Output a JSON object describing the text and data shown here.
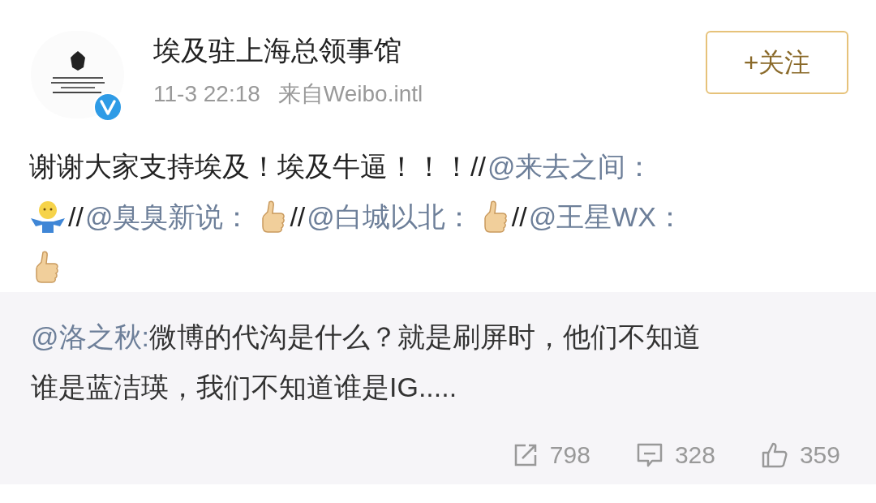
{
  "post": {
    "author": "埃及驻上海总领事馆",
    "verified": true,
    "time": "11-3 22:18",
    "source": "来自Weibo.intl",
    "follow_button": "+关注",
    "lines": [
      [
        {
          "kind": "text",
          "text": "谢谢大家支持埃及！埃及牛逼！！！"
        },
        {
          "kind": "text",
          "text": "//"
        },
        {
          "kind": "mention",
          "text": "@来去之间："
        }
      ],
      [
        {
          "kind": "emoji_shrug"
        },
        {
          "kind": "text",
          "text": "//"
        },
        {
          "kind": "mention",
          "text": "@臭臭新说："
        },
        {
          "kind": "emoji_thumbs"
        },
        {
          "kind": "text",
          "text": "//"
        },
        {
          "kind": "mention",
          "text": "@白城以北："
        },
        {
          "kind": "emoji_thumbs"
        },
        {
          "kind": "text",
          "text": "//"
        },
        {
          "kind": "mention",
          "text": "@王星WX："
        }
      ],
      [
        {
          "kind": "emoji_thumbs"
        }
      ]
    ]
  },
  "repost": {
    "lines": [
      [
        {
          "kind": "mention",
          "text": "@洛之秋:"
        },
        {
          "kind": "text",
          "text": "微博的代沟是什么？就是刷屏时，他们不知道"
        }
      ],
      [
        {
          "kind": "text",
          "text": "谁是蓝洁瑛，我们不知道谁是IG....."
        }
      ]
    ],
    "actions": [
      {
        "kind": "repost",
        "count": "798"
      },
      {
        "kind": "comment",
        "count": "328"
      },
      {
        "kind": "like",
        "count": "359"
      }
    ]
  }
}
